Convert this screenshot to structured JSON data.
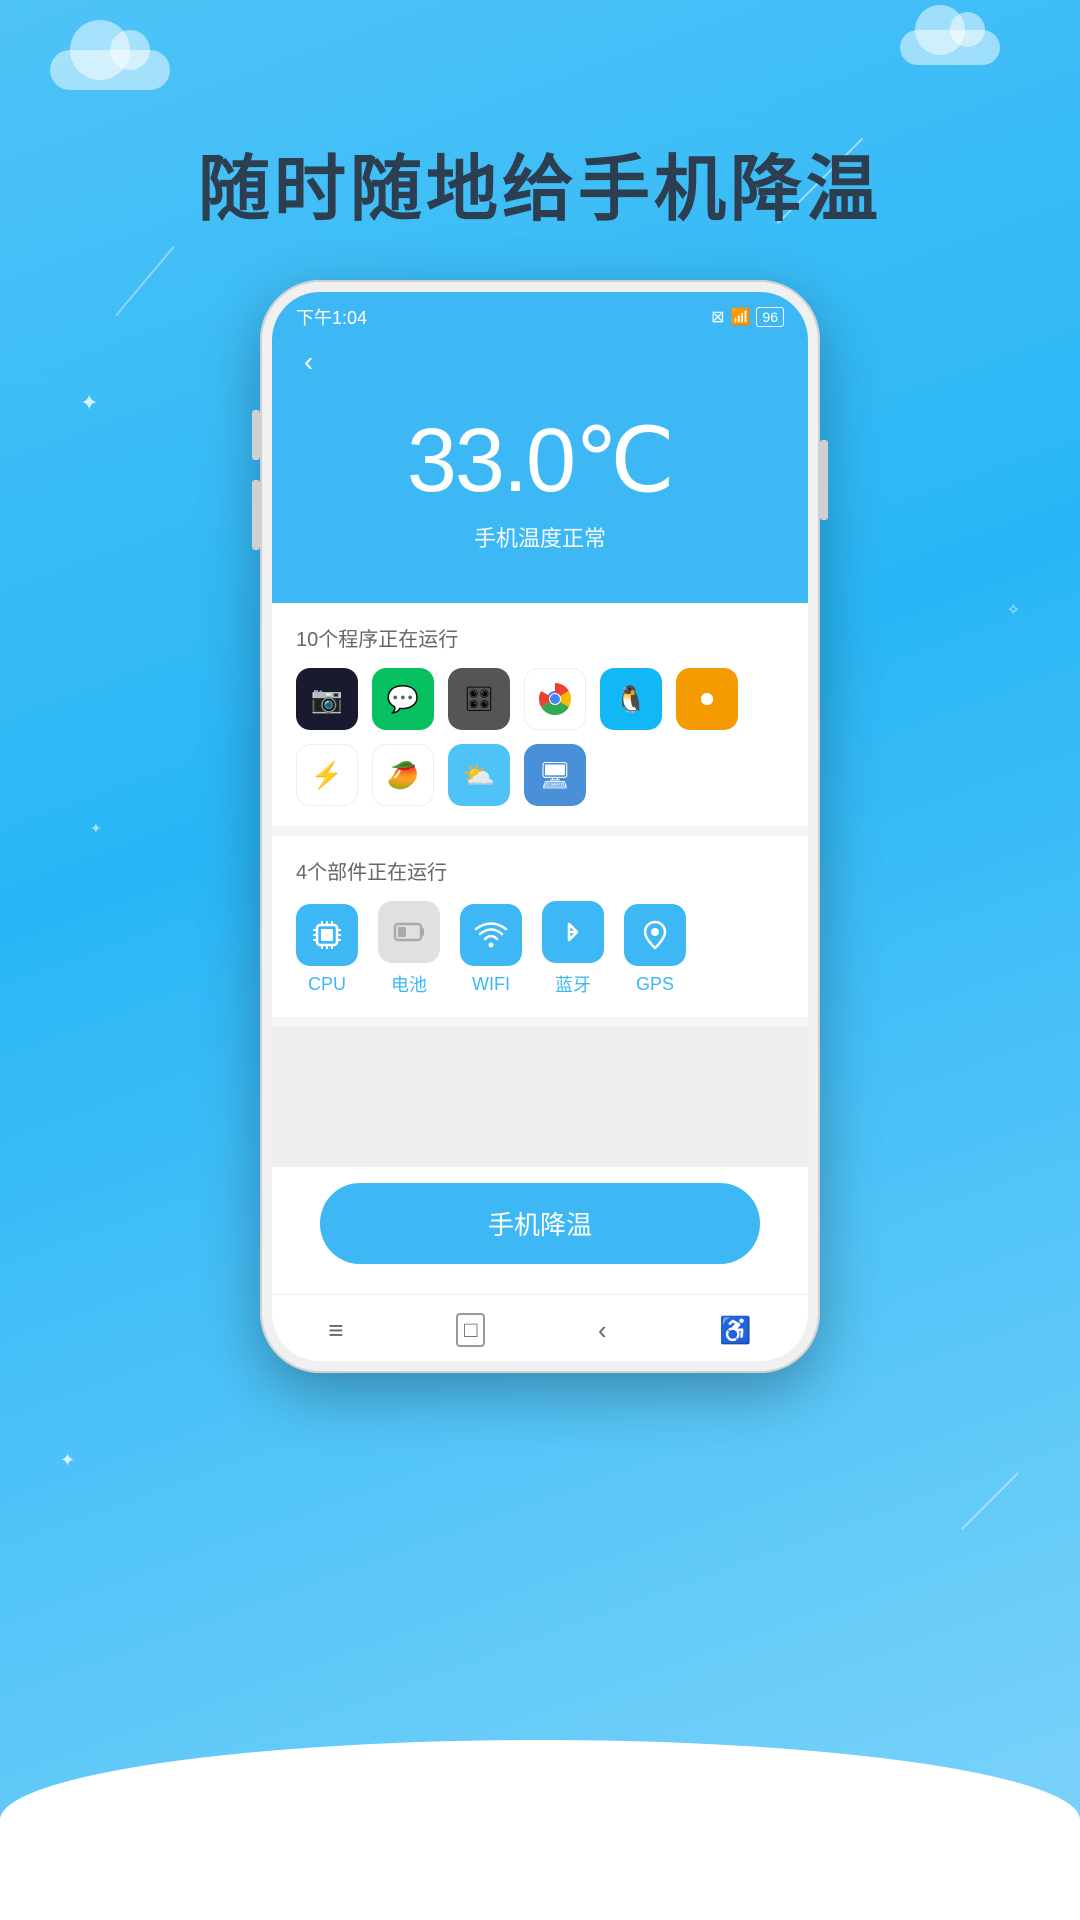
{
  "app": {
    "background_color": "#3db8f5",
    "tagline": "随时随地给手机降温"
  },
  "status_bar": {
    "time": "下午1:04",
    "battery": "96",
    "wifi_icon": "wifi",
    "battery_icon": "battery"
  },
  "header": {
    "back_label": "‹"
  },
  "temperature": {
    "value": "33.0℃",
    "status_text": "手机温度正常"
  },
  "running_apps": {
    "label": "10个程序正在运行",
    "apps": [
      {
        "name": "camera-app",
        "type": "cam",
        "emoji": "📷"
      },
      {
        "name": "wechat-app",
        "type": "wechat",
        "emoji": "💬"
      },
      {
        "name": "audio-app",
        "type": "audio",
        "emoji": "🎛"
      },
      {
        "name": "chrome-app",
        "type": "chrome",
        "emoji": "🌐"
      },
      {
        "name": "qq-app",
        "type": "qq",
        "emoji": "🐧"
      },
      {
        "name": "orange-app",
        "type": "orange",
        "emoji": "🔴"
      },
      {
        "name": "speed-app",
        "type": "green",
        "emoji": "⚡"
      },
      {
        "name": "mango-app",
        "type": "mango",
        "emoji": "🥭"
      },
      {
        "name": "weather-app",
        "type": "weather",
        "emoji": "🌤"
      },
      {
        "name": "remote-app",
        "type": "remote",
        "emoji": "🖥"
      }
    ]
  },
  "running_components": {
    "label": "4个部件正在运行",
    "components": [
      {
        "name": "cpu-component",
        "label": "CPU",
        "icon": "cpu",
        "type": "comp-cpu"
      },
      {
        "name": "battery-component",
        "label": "电池",
        "icon": "battery",
        "type": "comp-battery"
      },
      {
        "name": "wifi-component",
        "label": "WIFI",
        "icon": "wifi",
        "type": "comp-wifi"
      },
      {
        "name": "bluetooth-component",
        "label": "蓝牙",
        "icon": "bt",
        "type": "comp-bluetooth"
      },
      {
        "name": "gps-component",
        "label": "GPS",
        "icon": "gps",
        "type": "comp-gps"
      }
    ]
  },
  "cool_button": {
    "label": "手机降温"
  },
  "nav_bar": {
    "items": [
      {
        "name": "nav-menu",
        "icon": "≡"
      },
      {
        "name": "nav-home",
        "icon": "□"
      },
      {
        "name": "nav-back",
        "icon": "‹"
      },
      {
        "name": "nav-accessibility",
        "icon": "♿"
      }
    ]
  }
}
